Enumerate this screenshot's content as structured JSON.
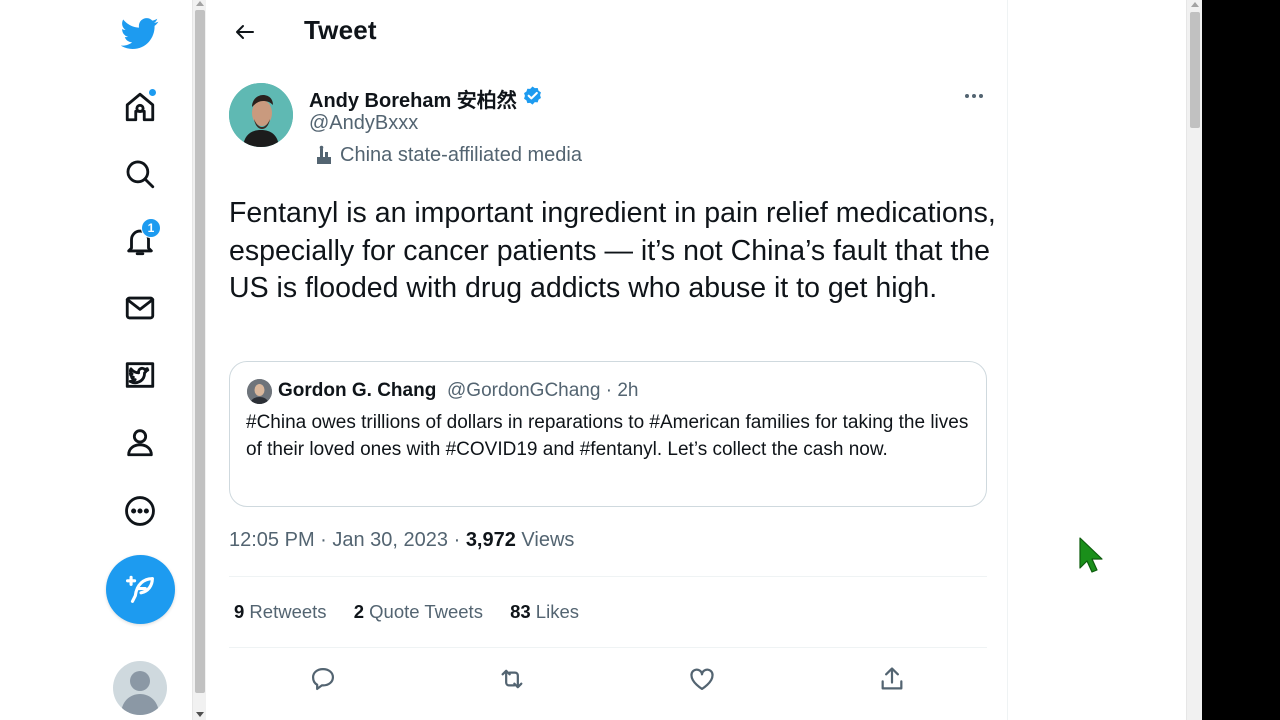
{
  "header": {
    "title": "Tweet"
  },
  "nav": {
    "notification_count": "1"
  },
  "tweet": {
    "author_name": "Andy Boreham 安柏然",
    "author_handle": "@AndyBxxx",
    "affiliation_label": "China state-affiliated media",
    "text": "Fentanyl is an important ingredient in pain relief medications, especially for cancer patients — it’s not China’s fault that the US is flooded with drug addicts who abuse it to get high.",
    "timestamp": "12:05 PM · Jan 30, 2023 · ",
    "views_count": "3,972",
    "views_label": " Views"
  },
  "quote": {
    "author_name": "Gordon G. Chang",
    "author_handle": "@GordonGChang · 2h",
    "text": "#China owes trillions of dollars in reparations to #American families for taking the lives of their loved ones with #COVID19 and #fentanyl. Let’s collect the cash now."
  },
  "stats": {
    "retweets_count": "9",
    "retweets_label": " Retweets",
    "quotes_count": "2",
    "quotes_label": " Quote Tweets",
    "likes_count": "83",
    "likes_label": " Likes"
  },
  "colors": {
    "accent": "#1d9bf0",
    "text_primary": "#0f1419",
    "text_secondary": "#536471",
    "border": "#cfd9de",
    "cursor": "#1a8f1a"
  },
  "icons": {
    "nav": [
      "twitter-logo-icon",
      "home-icon",
      "search-icon",
      "notifications-bell-icon",
      "messages-envelope-icon",
      "twitter-blue-icon",
      "profile-icon",
      "more-circle-icon",
      "compose-feather-icon"
    ],
    "actions": [
      "reply-icon",
      "retweet-icon",
      "like-heart-icon",
      "share-icon"
    ]
  }
}
